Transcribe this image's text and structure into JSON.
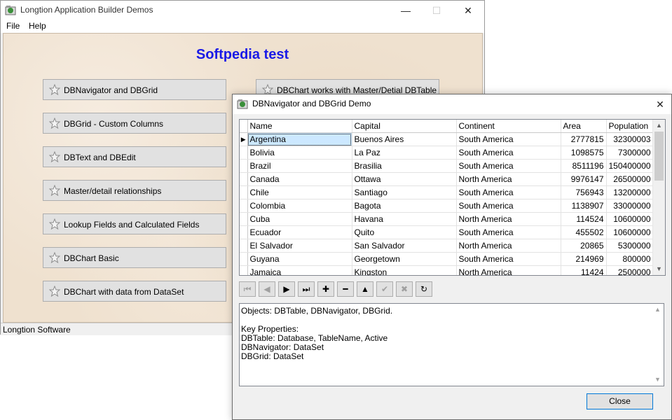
{
  "main_window": {
    "title": "Longtion Application Builder Demos",
    "menu": [
      "File",
      "Help"
    ],
    "canvas_title": "Softpedia test",
    "buttons_left": [
      "DBNavigator and DBGrid",
      "DBGrid - Custom Columns",
      "DBText and DBEdit",
      "Master/detail relationships",
      "Lookup Fields and Calculated Fields",
      "DBChart Basic",
      "DBChart with data from DataSet"
    ],
    "buttons_right": [
      "DBChart works with Master/Detial DBTable"
    ],
    "status": "Longtion Software"
  },
  "dialog": {
    "title": "DBNavigator and DBGrid Demo",
    "columns": [
      "Name",
      "Capital",
      "Continent",
      "Area",
      "Population"
    ],
    "rows": [
      [
        "Argentina",
        "Buenos Aires",
        "South America",
        "2777815",
        "32300003"
      ],
      [
        "Bolivia",
        "La Paz",
        "South America",
        "1098575",
        "7300000"
      ],
      [
        "Brazil",
        "Brasilia",
        "South America",
        "8511196",
        "150400000"
      ],
      [
        "Canada",
        "Ottawa",
        "North America",
        "9976147",
        "26500000"
      ],
      [
        "Chile",
        "Santiago",
        "South America",
        "756943",
        "13200000"
      ],
      [
        "Colombia",
        "Bagota",
        "South America",
        "1138907",
        "33000000"
      ],
      [
        "Cuba",
        "Havana",
        "North America",
        "114524",
        "10600000"
      ],
      [
        "Ecuador",
        "Quito",
        "South America",
        "455502",
        "10600000"
      ],
      [
        "El Salvador",
        "San Salvador",
        "North America",
        "20865",
        "5300000"
      ],
      [
        "Guyana",
        "Georgetown",
        "South America",
        "214969",
        "800000"
      ],
      [
        "Jamaica",
        "Kingston",
        "North America",
        "11424",
        "2500000"
      ]
    ],
    "selected_row": 0,
    "navigator": [
      {
        "name": "first-record-button",
        "glyph": "⏮",
        "enabled": false
      },
      {
        "name": "prior-record-button",
        "glyph": "◀",
        "enabled": false
      },
      {
        "name": "next-record-button",
        "glyph": "▶",
        "enabled": true
      },
      {
        "name": "last-record-button",
        "glyph": "⏭",
        "enabled": true
      },
      {
        "name": "insert-record-button",
        "glyph": "✚",
        "enabled": true
      },
      {
        "name": "delete-record-button",
        "glyph": "━",
        "enabled": true
      },
      {
        "name": "edit-record-button",
        "glyph": "▲",
        "enabled": true
      },
      {
        "name": "post-record-button",
        "glyph": "✔",
        "enabled": false
      },
      {
        "name": "cancel-record-button",
        "glyph": "✖",
        "enabled": false
      },
      {
        "name": "refresh-button",
        "glyph": "↻",
        "enabled": true
      }
    ],
    "memo_lines": [
      "Objects: DBTable, DBNavigator, DBGrid.",
      "",
      "Key Properties:",
      "DBTable: Database, TableName, Active",
      "DBNavigator: DataSet",
      "DBGrid: DataSet"
    ],
    "close_label": "Close"
  },
  "icons": {
    "minimize": "—",
    "maximize": "☐",
    "close": "✕",
    "scroll_up": "▲",
    "scroll_down": "▼",
    "row_indicator": "▶"
  },
  "colors": {
    "canvas_title": "#1a1ae6",
    "selection": "#cce8ff",
    "default_button_border": "#0078d7"
  }
}
